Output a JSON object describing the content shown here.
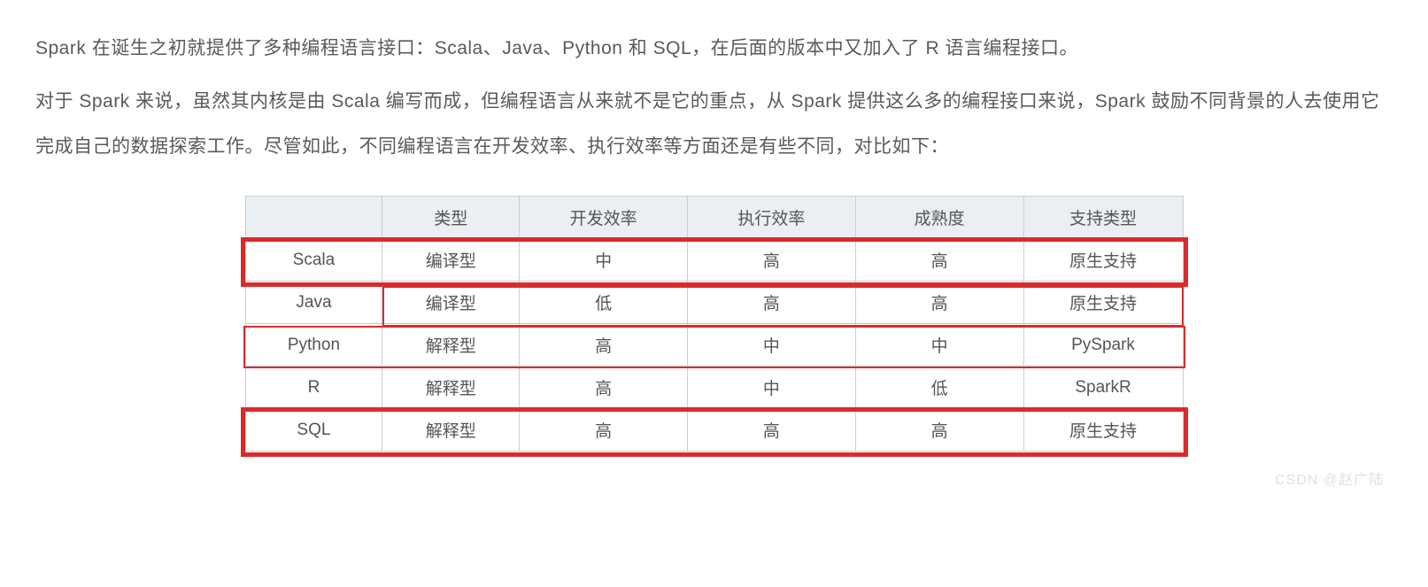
{
  "paragraphs": {
    "p1": "Spark 在诞生之初就提供了多种编程语言接口：Scala、Java、Python 和 SQL，在后面的版本中又加入了 R 语言编程接口。",
    "p2": "对于 Spark 来说，虽然其内核是由 Scala 编写而成，但编程语言从来就不是它的重点，从 Spark 提供这么多的编程接口来说，Spark 鼓励不同背景的人去使用它完成自己的数据探索工作。尽管如此，不同编程语言在开发效率、执行效率等方面还是有些不同，对比如下："
  },
  "table": {
    "headers": [
      "",
      "类型",
      "开发效率",
      "执行效率",
      "成熟度",
      "支持类型"
    ],
    "rows": [
      {
        "name": "Scala",
        "type": "编译型",
        "dev": "中",
        "exec": "高",
        "maturity": "高",
        "support": "原生支持"
      },
      {
        "name": "Java",
        "type": "编译型",
        "dev": "低",
        "exec": "高",
        "maturity": "高",
        "support": "原生支持"
      },
      {
        "name": "Python",
        "type": "解释型",
        "dev": "高",
        "exec": "中",
        "maturity": "中",
        "support": "PySpark"
      },
      {
        "name": "R",
        "type": "解释型",
        "dev": "高",
        "exec": "中",
        "maturity": "低",
        "support": "SparkR"
      },
      {
        "name": "SQL",
        "type": "解释型",
        "dev": "高",
        "exec": "高",
        "maturity": "高",
        "support": "原生支持"
      }
    ]
  },
  "watermark": "CSDN @赵广陆"
}
